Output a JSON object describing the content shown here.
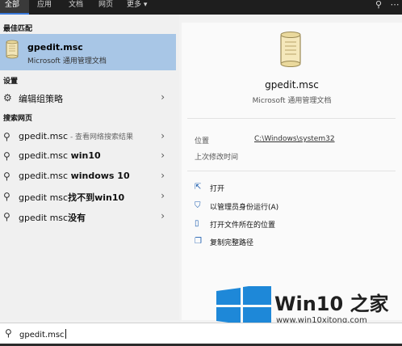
{
  "tabs": [
    "全部",
    "应用",
    "文档",
    "网页",
    "更多"
  ],
  "best_match": {
    "section": "最佳匹配",
    "title": "gpedit.msc",
    "subtitle": "Microsoft 通用管理文档"
  },
  "settings": {
    "section": "设置",
    "items": [
      {
        "label": "编辑组策略"
      }
    ]
  },
  "web": {
    "section": "搜索网页",
    "items": [
      {
        "main": "gpedit.msc",
        "bold": "",
        "hint": " - 查看网络搜索结果"
      },
      {
        "main": "gpedit.msc ",
        "bold": "win10",
        "hint": ""
      },
      {
        "main": "gpedit.msc ",
        "bold": "windows 10",
        "hint": ""
      },
      {
        "main": "gpedit msc",
        "bold": "找不到win10",
        "hint": ""
      },
      {
        "main": "gpedit msc",
        "bold": "没有",
        "hint": ""
      }
    ]
  },
  "detail": {
    "title": "gpedit.msc",
    "subtitle": "Microsoft 通用管理文档",
    "location_label": "位置",
    "location_value": "C:\\Windows\\system32",
    "modified_label": "上次修改时间",
    "actions": [
      {
        "label": "打开",
        "icon": "open-icon"
      },
      {
        "label": "以管理员身份运行(A)",
        "icon": "shield-icon"
      },
      {
        "label": "打开文件所在的位置",
        "icon": "folder-icon"
      },
      {
        "label": "复制完整路径",
        "icon": "copy-icon"
      }
    ]
  },
  "search": {
    "value": "gpedit.msc"
  },
  "watermark": {
    "brand": "Win10 之家",
    "url": "www.win10xitong.com"
  },
  "colors": {
    "accent": "#3a78d8",
    "selected": "#a8c6e6",
    "logo_blue": "#1e88d8"
  }
}
